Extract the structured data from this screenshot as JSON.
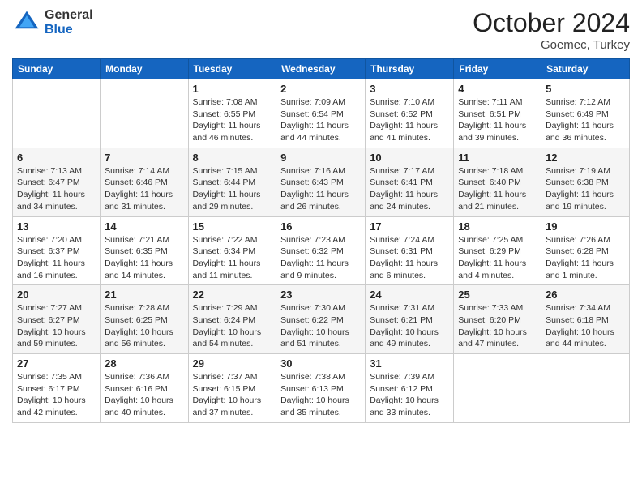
{
  "logo": {
    "general": "General",
    "blue": "Blue"
  },
  "header": {
    "month": "October 2024",
    "location": "Goemec, Turkey"
  },
  "days_of_week": [
    "Sunday",
    "Monday",
    "Tuesday",
    "Wednesday",
    "Thursday",
    "Friday",
    "Saturday"
  ],
  "weeks": [
    [
      {
        "day": "",
        "sunrise": "",
        "sunset": "",
        "daylight": ""
      },
      {
        "day": "",
        "sunrise": "",
        "sunset": "",
        "daylight": ""
      },
      {
        "day": "1",
        "sunrise": "Sunrise: 7:08 AM",
        "sunset": "Sunset: 6:55 PM",
        "daylight": "Daylight: 11 hours and 46 minutes."
      },
      {
        "day": "2",
        "sunrise": "Sunrise: 7:09 AM",
        "sunset": "Sunset: 6:54 PM",
        "daylight": "Daylight: 11 hours and 44 minutes."
      },
      {
        "day": "3",
        "sunrise": "Sunrise: 7:10 AM",
        "sunset": "Sunset: 6:52 PM",
        "daylight": "Daylight: 11 hours and 41 minutes."
      },
      {
        "day": "4",
        "sunrise": "Sunrise: 7:11 AM",
        "sunset": "Sunset: 6:51 PM",
        "daylight": "Daylight: 11 hours and 39 minutes."
      },
      {
        "day": "5",
        "sunrise": "Sunrise: 7:12 AM",
        "sunset": "Sunset: 6:49 PM",
        "daylight": "Daylight: 11 hours and 36 minutes."
      }
    ],
    [
      {
        "day": "6",
        "sunrise": "Sunrise: 7:13 AM",
        "sunset": "Sunset: 6:47 PM",
        "daylight": "Daylight: 11 hours and 34 minutes."
      },
      {
        "day": "7",
        "sunrise": "Sunrise: 7:14 AM",
        "sunset": "Sunset: 6:46 PM",
        "daylight": "Daylight: 11 hours and 31 minutes."
      },
      {
        "day": "8",
        "sunrise": "Sunrise: 7:15 AM",
        "sunset": "Sunset: 6:44 PM",
        "daylight": "Daylight: 11 hours and 29 minutes."
      },
      {
        "day": "9",
        "sunrise": "Sunrise: 7:16 AM",
        "sunset": "Sunset: 6:43 PM",
        "daylight": "Daylight: 11 hours and 26 minutes."
      },
      {
        "day": "10",
        "sunrise": "Sunrise: 7:17 AM",
        "sunset": "Sunset: 6:41 PM",
        "daylight": "Daylight: 11 hours and 24 minutes."
      },
      {
        "day": "11",
        "sunrise": "Sunrise: 7:18 AM",
        "sunset": "Sunset: 6:40 PM",
        "daylight": "Daylight: 11 hours and 21 minutes."
      },
      {
        "day": "12",
        "sunrise": "Sunrise: 7:19 AM",
        "sunset": "Sunset: 6:38 PM",
        "daylight": "Daylight: 11 hours and 19 minutes."
      }
    ],
    [
      {
        "day": "13",
        "sunrise": "Sunrise: 7:20 AM",
        "sunset": "Sunset: 6:37 PM",
        "daylight": "Daylight: 11 hours and 16 minutes."
      },
      {
        "day": "14",
        "sunrise": "Sunrise: 7:21 AM",
        "sunset": "Sunset: 6:35 PM",
        "daylight": "Daylight: 11 hours and 14 minutes."
      },
      {
        "day": "15",
        "sunrise": "Sunrise: 7:22 AM",
        "sunset": "Sunset: 6:34 PM",
        "daylight": "Daylight: 11 hours and 11 minutes."
      },
      {
        "day": "16",
        "sunrise": "Sunrise: 7:23 AM",
        "sunset": "Sunset: 6:32 PM",
        "daylight": "Daylight: 11 hours and 9 minutes."
      },
      {
        "day": "17",
        "sunrise": "Sunrise: 7:24 AM",
        "sunset": "Sunset: 6:31 PM",
        "daylight": "Daylight: 11 hours and 6 minutes."
      },
      {
        "day": "18",
        "sunrise": "Sunrise: 7:25 AM",
        "sunset": "Sunset: 6:29 PM",
        "daylight": "Daylight: 11 hours and 4 minutes."
      },
      {
        "day": "19",
        "sunrise": "Sunrise: 7:26 AM",
        "sunset": "Sunset: 6:28 PM",
        "daylight": "Daylight: 11 hours and 1 minute."
      }
    ],
    [
      {
        "day": "20",
        "sunrise": "Sunrise: 7:27 AM",
        "sunset": "Sunset: 6:27 PM",
        "daylight": "Daylight: 10 hours and 59 minutes."
      },
      {
        "day": "21",
        "sunrise": "Sunrise: 7:28 AM",
        "sunset": "Sunset: 6:25 PM",
        "daylight": "Daylight: 10 hours and 56 minutes."
      },
      {
        "day": "22",
        "sunrise": "Sunrise: 7:29 AM",
        "sunset": "Sunset: 6:24 PM",
        "daylight": "Daylight: 10 hours and 54 minutes."
      },
      {
        "day": "23",
        "sunrise": "Sunrise: 7:30 AM",
        "sunset": "Sunset: 6:22 PM",
        "daylight": "Daylight: 10 hours and 51 minutes."
      },
      {
        "day": "24",
        "sunrise": "Sunrise: 7:31 AM",
        "sunset": "Sunset: 6:21 PM",
        "daylight": "Daylight: 10 hours and 49 minutes."
      },
      {
        "day": "25",
        "sunrise": "Sunrise: 7:33 AM",
        "sunset": "Sunset: 6:20 PM",
        "daylight": "Daylight: 10 hours and 47 minutes."
      },
      {
        "day": "26",
        "sunrise": "Sunrise: 7:34 AM",
        "sunset": "Sunset: 6:18 PM",
        "daylight": "Daylight: 10 hours and 44 minutes."
      }
    ],
    [
      {
        "day": "27",
        "sunrise": "Sunrise: 7:35 AM",
        "sunset": "Sunset: 6:17 PM",
        "daylight": "Daylight: 10 hours and 42 minutes."
      },
      {
        "day": "28",
        "sunrise": "Sunrise: 7:36 AM",
        "sunset": "Sunset: 6:16 PM",
        "daylight": "Daylight: 10 hours and 40 minutes."
      },
      {
        "day": "29",
        "sunrise": "Sunrise: 7:37 AM",
        "sunset": "Sunset: 6:15 PM",
        "daylight": "Daylight: 10 hours and 37 minutes."
      },
      {
        "day": "30",
        "sunrise": "Sunrise: 7:38 AM",
        "sunset": "Sunset: 6:13 PM",
        "daylight": "Daylight: 10 hours and 35 minutes."
      },
      {
        "day": "31",
        "sunrise": "Sunrise: 7:39 AM",
        "sunset": "Sunset: 6:12 PM",
        "daylight": "Daylight: 10 hours and 33 minutes."
      },
      {
        "day": "",
        "sunrise": "",
        "sunset": "",
        "daylight": ""
      },
      {
        "day": "",
        "sunrise": "",
        "sunset": "",
        "daylight": ""
      }
    ]
  ]
}
